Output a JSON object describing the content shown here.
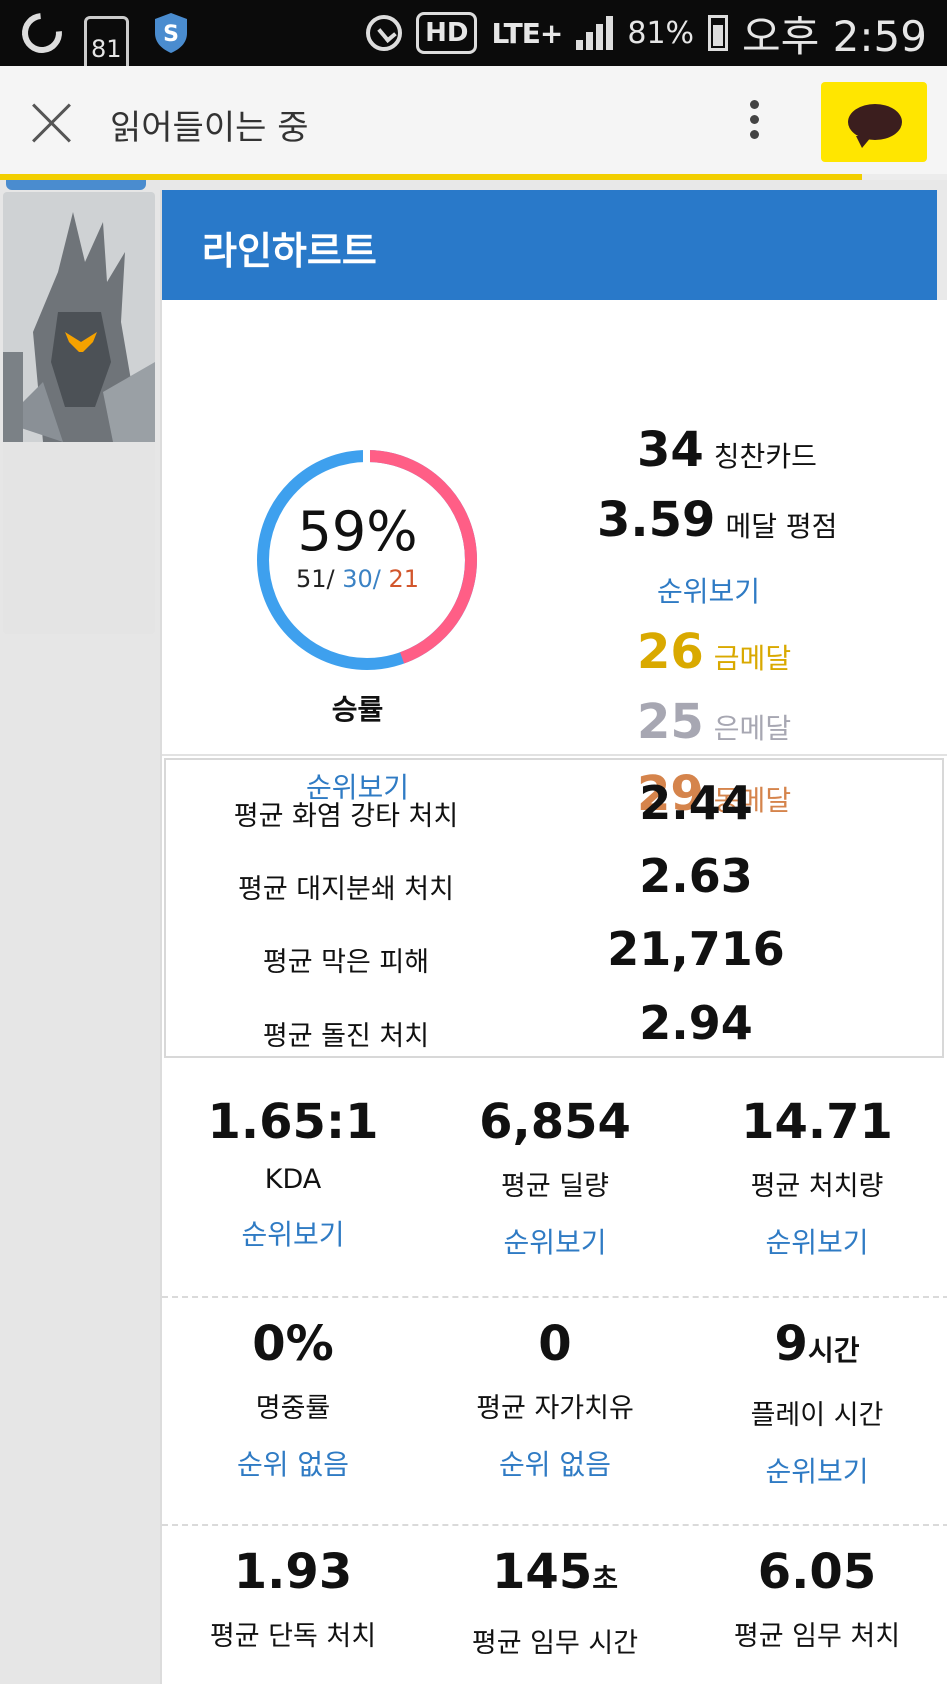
{
  "status_bar": {
    "noti_count": "81",
    "network": "HD",
    "lte": "LTE+",
    "battery": "81%",
    "time": "오후 2:59"
  },
  "appbar": {
    "title": "읽어들이는 중",
    "load_progress": 0.91
  },
  "hero": {
    "name": "라인하르트"
  },
  "winrate": {
    "percent_label": "59%",
    "wins": "51",
    "losses": "30",
    "draws": "21",
    "sep": "/",
    "label": "승률",
    "rank_link": "순위보기",
    "fraction": 0.59,
    "colors": {
      "win": "#ff5e86",
      "rest": "#3ea0ee"
    }
  },
  "summary": {
    "cards_value": "34",
    "cards_label": "칭찬카드",
    "medal_score_value": "3.59",
    "medal_score_label": "메달 평점",
    "rank_link": "순위보기",
    "gold_value": "26",
    "gold_label": "금메달",
    "silver_value": "25",
    "silver_label": "은메달",
    "bronze_value": "29",
    "bronze_label": "동메달"
  },
  "hero_specific": [
    {
      "label": "평균 화염 강타 처치",
      "value": "2.44"
    },
    {
      "label": "평균 대지분쇄 처치",
      "value": "2.63"
    },
    {
      "label": "평균 막은 피해",
      "value": "21,716"
    },
    {
      "label": "평균 돌진 처치",
      "value": "2.94"
    }
  ],
  "stats_row1": [
    {
      "value": "1.65:1",
      "unit": "",
      "label": "KDA",
      "link": "순위보기"
    },
    {
      "value": "6,854",
      "unit": "",
      "label": "평균 딜량",
      "link": "순위보기"
    },
    {
      "value": "14.71",
      "unit": "",
      "label": "평균 처치량",
      "link": "순위보기"
    }
  ],
  "stats_row2": [
    {
      "value": "0%",
      "unit": "",
      "label": "명중률",
      "link": "순위 없음"
    },
    {
      "value": "0",
      "unit": "",
      "label": "평균 자가치유",
      "link": "순위 없음"
    },
    {
      "value": "9",
      "unit": "시간",
      "label": "플레이 시간",
      "link": "순위보기"
    }
  ],
  "stats_row3": [
    {
      "value": "1.93",
      "unit": "",
      "label": "평균 단독 처치"
    },
    {
      "value": "145",
      "unit": "초",
      "label": "평균 임무 시간"
    },
    {
      "value": "6.05",
      "unit": "",
      "label": "평균 임무 처치"
    }
  ]
}
